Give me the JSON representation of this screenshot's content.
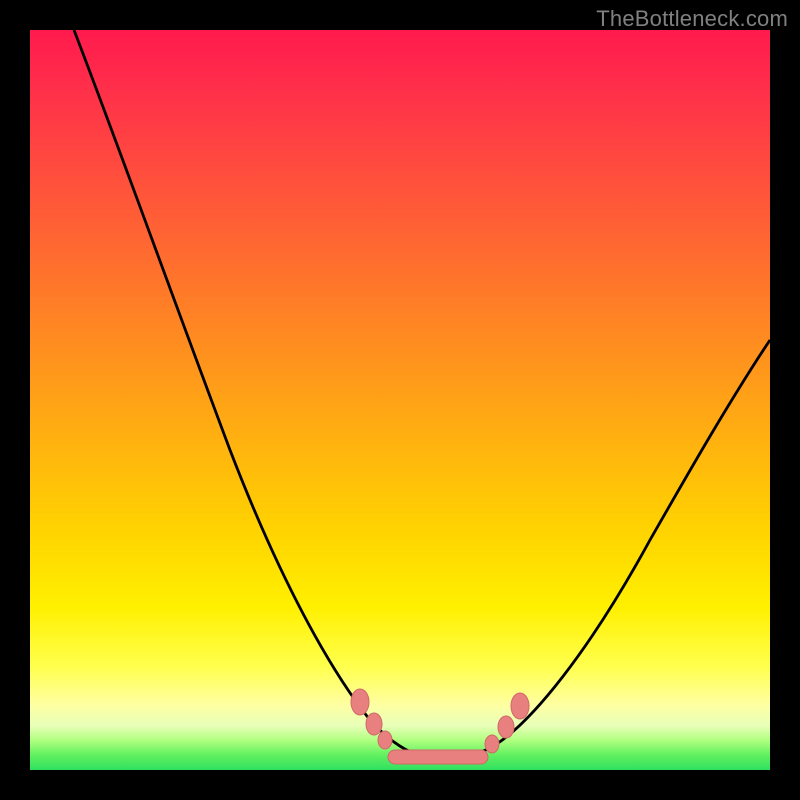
{
  "watermark": "TheBottleneck.com",
  "colors": {
    "page_bg": "#000000",
    "gradient_top": "#ff1a4d",
    "gradient_mid": "#ffd400",
    "gradient_bottom": "#30e060",
    "curve": "#000000",
    "marker_fill": "#e98080",
    "marker_stroke": "#c96060"
  },
  "chart_data": {
    "type": "line",
    "title": "",
    "xlabel": "",
    "ylabel": "",
    "xlim": [
      0,
      100
    ],
    "ylim": [
      0,
      100
    ],
    "grid": false,
    "legend": false,
    "series": [
      {
        "name": "curve",
        "x": [
          6,
          10,
          14,
          18,
          22,
          26,
          30,
          34,
          38,
          42,
          46,
          48,
          50,
          52,
          54,
          56,
          58,
          60,
          64,
          68,
          72,
          76,
          80,
          84,
          88,
          92,
          96,
          100
        ],
        "values": [
          100,
          90,
          80,
          70,
          61,
          52,
          44,
          36,
          29,
          22,
          15,
          12,
          9,
          6,
          4,
          2,
          1,
          2,
          5,
          10,
          16,
          22,
          28,
          34,
          40,
          46,
          52,
          58
        ]
      }
    ],
    "markers": {
      "name": "valley-points",
      "x": [
        43,
        45,
        47.5,
        50,
        52.5,
        55,
        57.5,
        60,
        62,
        64
      ],
      "values": [
        11,
        8,
        5,
        2.5,
        2,
        2,
        2.2,
        3,
        6,
        9
      ]
    },
    "annotations": [
      {
        "text": "TheBottleneck.com",
        "position": "top-right"
      }
    ]
  }
}
